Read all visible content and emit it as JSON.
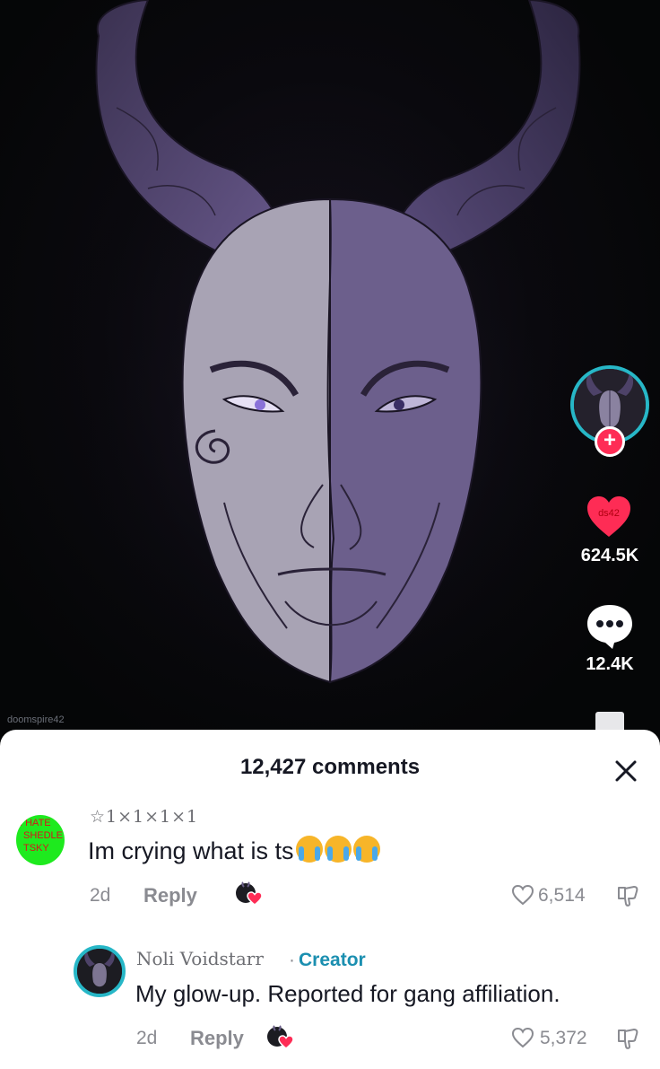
{
  "video": {
    "watermark": "doomspire42"
  },
  "rail": {
    "like_tag": "ds42",
    "like_count": "624.5K",
    "comment_count": "12.4K",
    "follow_symbol": "+",
    "icons": [
      "avatar",
      "plus-icon",
      "heart-icon",
      "comment-bubble-icon",
      "bookmark-icon"
    ]
  },
  "comments_panel": {
    "title": "12,427 comments",
    "close_symbol": "✕",
    "comments": [
      {
        "badge_lines": [
          "I HATE",
          "SHEDLE",
          "TSKY"
        ],
        "username": "☆1×1×1×1",
        "text": "Im crying what is ts",
        "emoji_count": 3,
        "emoji": "loudly-crying-face",
        "time": "2d",
        "reply_label": "Reply",
        "likes": "6,514",
        "liked_by_creator": true
      },
      {
        "username": "Noli Voidstarr",
        "creator_label": "Creator",
        "separator": "·",
        "text": "My glow-up. Reported for gang affiliation.",
        "time": "2d",
        "reply_label": "Reply",
        "likes": "5,372",
        "liked_by_creator": true
      }
    ]
  },
  "colors": {
    "accent_red": "#fe2c55",
    "ring_teal": "#27b7c7",
    "creator_blue": "#1b8fb0",
    "badge_green": "#1eea1e"
  }
}
